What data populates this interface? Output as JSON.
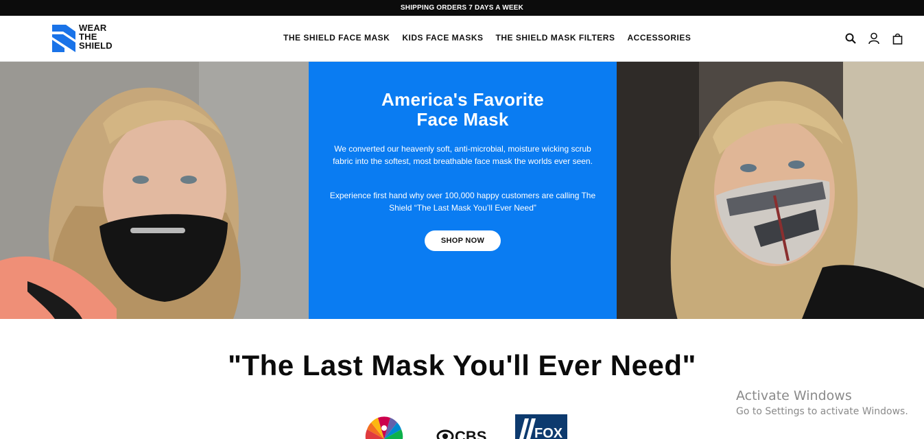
{
  "announcement": "SHIPPING ORDERS 7 DAYS A WEEK",
  "brand": {
    "line1": "WEAR",
    "line2": "THE",
    "line3": "SHIELD",
    "accent": "#0a7cf2"
  },
  "nav": [
    {
      "label": "THE SHIELD FACE MASK"
    },
    {
      "label": "KIDS FACE MASKS"
    },
    {
      "label": "THE SHIELD MASK FILTERS"
    },
    {
      "label": "ACCESSORIES"
    }
  ],
  "header_icons": [
    "search-icon",
    "account-icon",
    "cart-icon"
  ],
  "hero": {
    "title_line1": "America's Favorite",
    "title_line2": "Face Mask",
    "paragraph1": "We converted our heavenly soft, anti-microbial, moisture wicking scrub fabric into the softest, most breathable face mask the worlds ever seen.",
    "paragraph2": "Experience first hand why over 100,000 happy customers are calling The Shield “The Last Mask You’ll Ever Need”",
    "cta": "SHOP NOW",
    "panel_color": "#0a7cf2"
  },
  "tagline": "\"The Last Mask You'll Ever Need\"",
  "press_logos": [
    "nbc-logo",
    "cbs-logo",
    "fox-logo"
  ],
  "windows_watermark": {
    "line1": "Activate Windows",
    "line2": "Go to Settings to activate Windows."
  }
}
